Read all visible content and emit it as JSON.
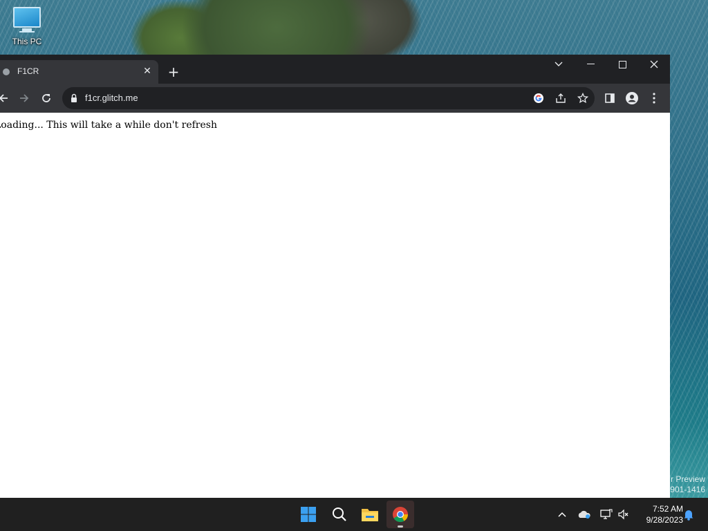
{
  "desktop": {
    "icons": [
      {
        "label": "This PC",
        "icon": "this-pc-icon"
      }
    ],
    "watermark_line1": "r Preview",
    "watermark_line2": "901-1416"
  },
  "browser": {
    "tab": {
      "title": "F1CR",
      "favicon": "globe-icon"
    },
    "address": {
      "url": "f1cr.glitch.me"
    },
    "page": {
      "text": "Loading... This will take a while don't refresh"
    }
  },
  "taskbar": {
    "apps": [
      "start-icon",
      "search-icon",
      "file-explorer-icon",
      "chrome-icon"
    ],
    "clock": {
      "time": "7:52 AM",
      "date": "9/28/2023"
    }
  },
  "colors": {
    "titlebar": "#202124",
    "toolbar": "#35363a",
    "omnibox": "#202124",
    "taskbar": "#202020",
    "accent": "#8ab4f8"
  }
}
